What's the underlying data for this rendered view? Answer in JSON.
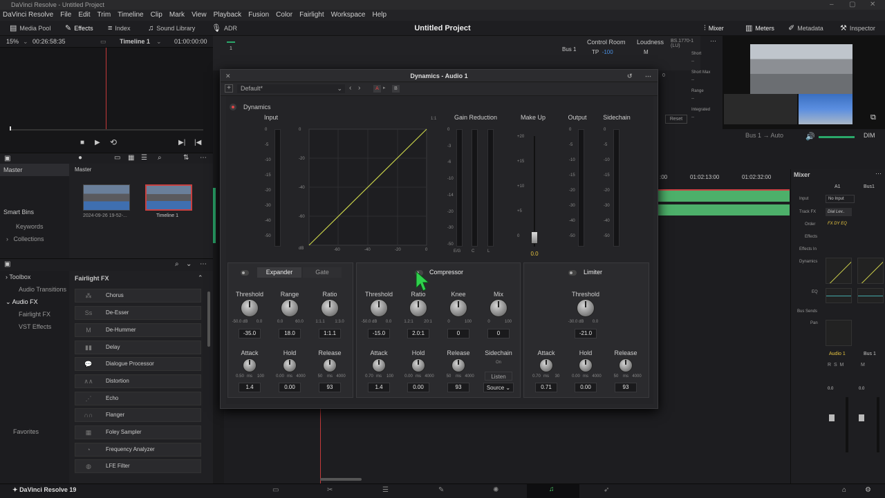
{
  "window": {
    "title": "DaVinci Resolve - Untitled Project"
  },
  "menu": [
    "DaVinci Resolve",
    "File",
    "Edit",
    "Trim",
    "Timeline",
    "Clip",
    "Mark",
    "View",
    "Playback",
    "Fusion",
    "Color",
    "Fairlight",
    "Workspace",
    "Help"
  ],
  "toolbar": {
    "media_pool": "Media Pool",
    "effects": "Effects",
    "index": "Index",
    "sound_library": "Sound Library",
    "adr": "ADR",
    "project_title": "Untitled Project",
    "mixer": "Mixer",
    "meters": "Meters",
    "metadata": "Metadata",
    "inspector": "Inspector"
  },
  "viewer": {
    "zoom": "15%",
    "timecode": "00:26:58:35",
    "timeline_name": "Timeline 1",
    "timeline_tc": "01:00:00:00"
  },
  "media": {
    "master_bin": "Master",
    "master_header": "Master",
    "smart_bins": "Smart Bins",
    "keywords": "Keywords",
    "collections": "Collections",
    "clips": [
      {
        "name": "2024-09-26 19-52-..."
      },
      {
        "name": "Timeline 1"
      }
    ]
  },
  "fx_tree": {
    "toolbox": "Toolbox",
    "audio_transitions": "Audio Transitions",
    "audio_fx": "Audio FX",
    "fairlight_fx": "Fairlight FX",
    "vst_effects": "VST Effects",
    "favorites": "Favorites"
  },
  "fx_list": {
    "header": "Fairlight FX",
    "items": [
      "Chorus",
      "De-Esser",
      "De-Hummer",
      "Delay",
      "Dialogue Processor",
      "Distortion",
      "Echo",
      "Flanger",
      "Foley Sampler",
      "Frequency Analyzer",
      "LFE Filter"
    ],
    "icons": [
      "Ss",
      "M"
    ]
  },
  "top": {
    "bus1": "Bus 1",
    "control_room": "Control Room",
    "loudness": "Loudness",
    "loudness_std": "BS.1770-1 (LU)",
    "tp": "TP",
    "tp_val": "-100",
    "m": "M",
    "short": "Short",
    "short_max": "Short Max",
    "range": "Range",
    "integrated": "Integrated",
    "reset": "Reset",
    "ruler": "1",
    "zero": "0",
    "dash": "--"
  },
  "timeline": {
    "bus_label": "Bus 1",
    "auto": "Auto",
    "dim": "DIM",
    "tc1": ":00",
    "tc2": "01:02:13:00",
    "tc3": "01:02:32:00"
  },
  "dynamics": {
    "title": "Dynamics - Audio 1",
    "preset": "Default*",
    "a": "A",
    "b": "B",
    "section": "Dynamics",
    "headers": {
      "input": "Input",
      "gain_reduction": "Gain Reduction",
      "make_up": "Make Up",
      "output": "Output",
      "sidechain": "Sidechain"
    },
    "ratio_1_1": "1:1",
    "makeup_value": "0.0",
    "input_scale": [
      "0",
      "-5",
      "-10",
      "-15",
      "-20",
      "-30",
      "-40",
      "-50"
    ],
    "graph_y": [
      "0",
      "-20",
      "-40",
      "-60",
      "dB"
    ],
    "graph_x": [
      "-60",
      "-40",
      "-20",
      "0"
    ],
    "gr_scale": [
      "0",
      "-3",
      "-6",
      "-10",
      "-14",
      "-20",
      "-30",
      "-50"
    ],
    "gr_labels": [
      "E/G",
      "C",
      "L"
    ],
    "makeup_scale": [
      "+20",
      "+15",
      "+10",
      "+5",
      "0"
    ],
    "expander": {
      "tab1": "Expander",
      "tab2": "Gate",
      "threshold": "Threshold",
      "range": "Range",
      "ratio": "Ratio",
      "th_val": "-35.0",
      "range_val": "18.0",
      "ratio_val": "1:1.1",
      "th_min": "-50.0 dB",
      "th_max": "0.0",
      "rg_min": "0.0",
      "rg_max": "60.0",
      "rt_min": "1:1.1",
      "rt_max": "1:3.0",
      "attack": "Attack",
      "hold": "Hold",
      "release": "Release",
      "at_val": "1.4",
      "hd_val": "0.00",
      "rl_val": "93",
      "at_min": "0.50",
      "at_max": "100",
      "hd_min": "0.00",
      "hd_max": "4000",
      "rl_min": "50",
      "rl_max": "4000",
      "ms": "ms"
    },
    "compressor": {
      "title": "Compressor",
      "threshold": "Threshold",
      "ratio": "Ratio",
      "knee": "Knee",
      "mix": "Mix",
      "th_val": "-15.0",
      "ratio_val": "2.0:1",
      "knee_val": "0",
      "mix_val": "0",
      "th_min": "-50.0 dB",
      "th_max": "0.0",
      "rt_min": "1.2:1",
      "rt_max": "20:1",
      "kn_min": "0",
      "kn_max": "100",
      "mx_min": "0",
      "mx_max": "100",
      "attack": "Attack",
      "hold": "Hold",
      "release": "Release",
      "sidechain": "Sidechain",
      "on": "On",
      "listen": "Listen",
      "source": "Source",
      "at_val": "1.4",
      "hd_val": "0.00",
      "rl_val": "93",
      "at_min": "0.70",
      "at_max": "100",
      "hd_min": "0.00",
      "hd_max": "4000",
      "rl_min": "50",
      "rl_max": "4000",
      "ms": "ms"
    },
    "limiter": {
      "title": "Limiter",
      "threshold": "Threshold",
      "th_val": "-21.0",
      "th_min": "-30.0 dB",
      "th_max": "0.0",
      "attack": "Attack",
      "hold": "Hold",
      "release": "Release",
      "at_val": "0.71",
      "hd_val": "0.00",
      "rl_val": "93",
      "at_min": "0.70",
      "at_max": "30",
      "hd_min": "0.00",
      "hd_max": "4000",
      "rl_min": "50",
      "rl_max": "4000",
      "ms": "ms"
    }
  },
  "mixer": {
    "title": "Mixer",
    "a1": "A1",
    "bus1": "Bus1",
    "input": "Input",
    "no_input": "No Input",
    "track_fx": "Track FX",
    "track_fx_val": "Dial Lev..",
    "order": "Order",
    "order_val": "FX DY EQ",
    "effects": "Effects",
    "effects_in": "Effects In",
    "dynamics": "Dynamics",
    "eq": "EQ",
    "bus_sends": "Bus Sends",
    "pan": "Pan",
    "audio1": "Audio 1",
    "bus1b": "Bus 1",
    "r": "R",
    "s": "S",
    "m": "M",
    "fader_val": "0.0"
  },
  "app": {
    "name": "DaVinci Resolve 19"
  }
}
